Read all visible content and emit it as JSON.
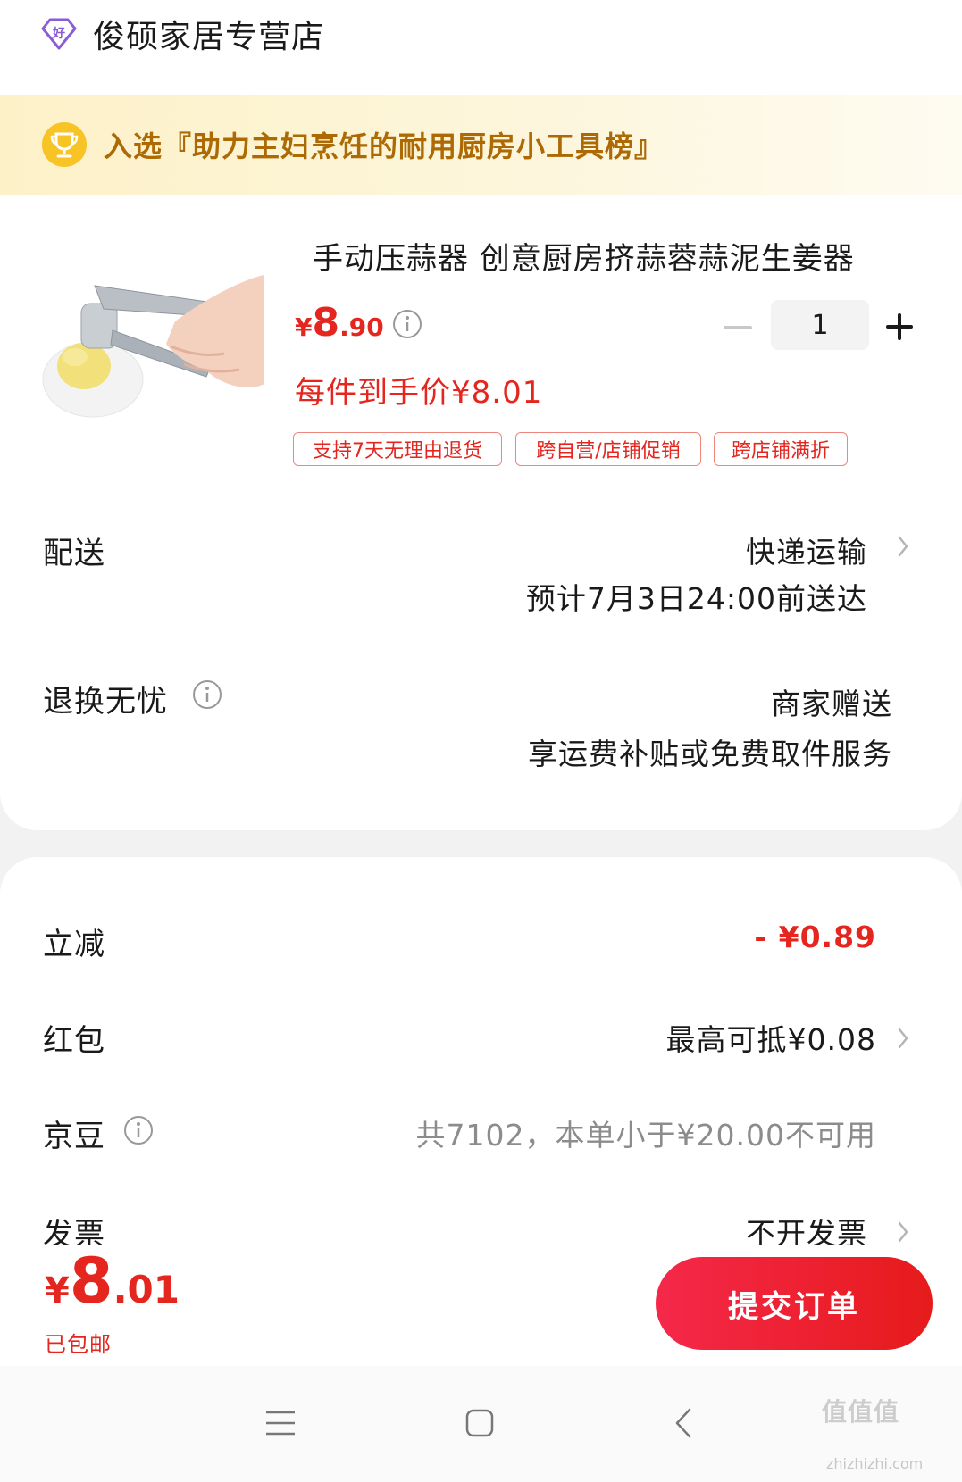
{
  "shop": {
    "name": "俊硕家居专营店",
    "badge_icon": "好-badge-icon"
  },
  "award_banner": {
    "icon": "trophy-icon",
    "text": "入选『助力主妇烹饪的耐用厨房小工具榜』"
  },
  "product": {
    "image": "garlic-press-image",
    "title": "手动压蒜器 创意厨房挤蒜蓉蒜泥生姜器",
    "price_symbol": "¥",
    "price_int": "8",
    "price_dec": ".90",
    "final_price": "每件到手价¥8.01",
    "quantity": "1",
    "tags": [
      "支持7天无理由退货",
      "跨自营/店铺促销",
      "跨店铺满折"
    ]
  },
  "delivery": {
    "label": "配送",
    "method": "快递运输",
    "eta": "预计7月3日24:00前送达"
  },
  "returns": {
    "label": "退换无忧",
    "value_line1": "商家赠送",
    "value_line2": "享运费补贴或免费取件服务"
  },
  "discounts": {
    "instant_label": "立减",
    "instant_value": "- ¥0.89",
    "redpacket_label": "红包",
    "redpacket_value": "最高可抵¥0.08",
    "beans_label": "京豆",
    "beans_value": "共7102，本单小于¥20.00不可用",
    "invoice_label": "发票",
    "invoice_value": "不开发票"
  },
  "bottom_bar": {
    "total_symbol": "¥",
    "total_int": "8",
    "total_dec": ".01",
    "shipping_note": "已包邮",
    "submit_label": "提交订单"
  },
  "watermark": {
    "text": "值值值",
    "sub": "zhizhizhi.com"
  },
  "colors": {
    "accent": "#e4261f",
    "banner_text": "#ad6a04",
    "banner_bg": "#fdf1c8"
  }
}
